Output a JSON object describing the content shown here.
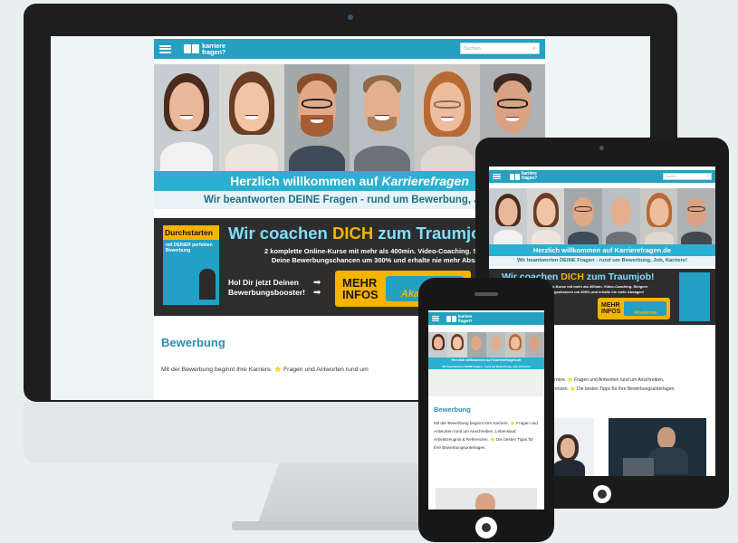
{
  "site": {
    "logo_line1": "karriere",
    "logo_line2": "fragen?",
    "search_placeholder": "Suchen",
    "welcome_prefix": "Herzlich willkommen auf ",
    "welcome_brand": "Karrierefragen",
    "welcome_tablet": "Herzlich willkommen auf Karrierefragen.de",
    "tagline_desktop": "Wir beantworten DEINE Fragen - rund um Bewerbung, Job,",
    "tagline_tablet": "Wir beantworten DEINE Fragen - rund um Bewerbung, Job, Karriere!",
    "tagline_phone": "Wir beantworten DEINE Fragen - rund um Bewerbung, Job, Karriere!",
    "section_title": "Bewerbung",
    "desktop_paragraph": "Mit der Bewerbung beginnt Ihre Karriere. ⭐ Fragen und Antworten rund um",
    "tablet_paragraph_1": "Ihre Karriere. ⭐ Fragen und Antworten rund um Anschreiben,",
    "tablet_paragraph_2": "& Referenzen. ⭐ Die besten Tipps für Ihre Bewerbungsunterlagen.",
    "phone_paragraph": "Mit der Bewerbung beginnt Ihre Karriere. ⭐ Fragen und Antworten rund um Anschreiben, Lebenslauf, Arbeitszeugnis & Referenzen. ⭐ Die besten Tipps für Ihre Bewerbungsunterlagen."
  },
  "coach": {
    "head_prefix": "Wir coachen ",
    "head_emph": "DICH",
    "head_suffix": " zum Traumjob!",
    "sub_1": "2 komplette Online-Kurse mit mehr als 400min. Video-Coaching. Steigere",
    "sub_2": "Deine Bewerbungschancen um 300% und erhalte nie mehr Absagen!",
    "booklet_title": "Durchstarten",
    "booklet_sub": "mit DEINER perfekten Bewerbung",
    "cta_left_1": "Hol Dir jetzt Deinen",
    "cta_left_2": "Bewerbungsbooster!",
    "btn_1": "MEHR",
    "btn_2": "INFOS",
    "btn_brand": "Akademie",
    "tablet_cta": "Jetzt Deinen ungsbooster!"
  },
  "colors": {
    "brand_blue": "#24a0c0",
    "accent_yellow": "#f6b400",
    "dark_banner": "#2d2d2d"
  }
}
